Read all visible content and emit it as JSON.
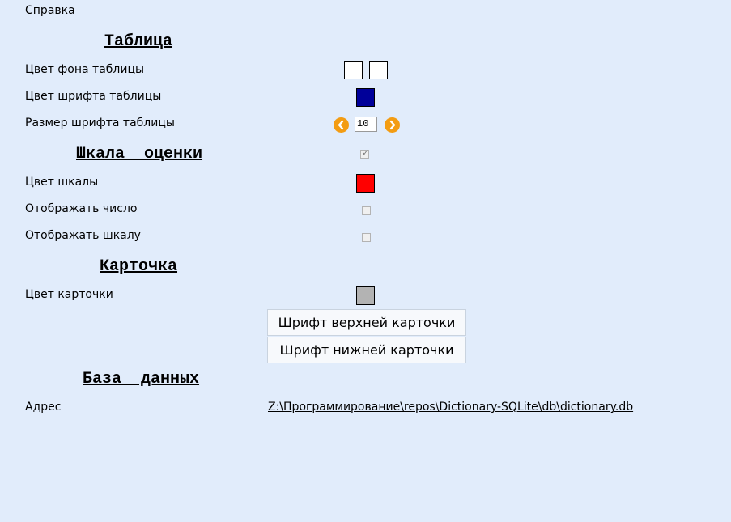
{
  "help_link": "Справка",
  "table": {
    "title": "Таблица",
    "bg_color_label": "Цвет фона таблицы",
    "bg_colors": [
      "#ffffff",
      "#ffffff"
    ],
    "font_color_label": "Цвет шрифта таблицы",
    "font_color": "#000099",
    "font_size_label": "Размер шрифта таблицы",
    "font_size_value": "10",
    "decrease_icon": "chevron-left-icon",
    "increase_icon": "chevron-right-icon"
  },
  "scale": {
    "title": "Шкала  оценки",
    "enabled": true,
    "color_label": "Цвет шкалы",
    "color": "#ff0000",
    "show_number_label": "Отображать число",
    "show_number": false,
    "show_scale_label": "Отображать шкалу",
    "show_scale": false
  },
  "card": {
    "title": "Карточка",
    "color_label": "Цвет карточки",
    "color": "#b3b3b3",
    "top_font_button": "Шрифт верхней карточки",
    "bottom_font_button": "Шрифт нижней карточки"
  },
  "database": {
    "title": "База  данных",
    "address_label": "Адрес",
    "address_path": "Z:\\Программирование\\repos\\Dictionary-SQLite\\db\\dictionary.db"
  },
  "colors": {
    "background": "#e1ecfb",
    "accent_orange": "#f39c12"
  }
}
